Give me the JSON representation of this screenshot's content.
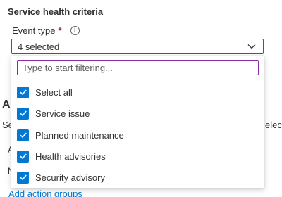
{
  "section": {
    "title": "Service health criteria"
  },
  "event_type": {
    "label": "Event type",
    "required_mark": "*",
    "info_icon": "info-icon",
    "selected_text": "4 selected"
  },
  "filter": {
    "placeholder": "Type to start filtering..."
  },
  "options": [
    {
      "label": "Select all",
      "checked": true
    },
    {
      "label": "Service issue",
      "checked": true
    },
    {
      "label": "Planned maintenance",
      "checked": true
    },
    {
      "label": "Health advisories",
      "checked": true
    },
    {
      "label": "Security advisory",
      "checked": true
    }
  ],
  "background": {
    "heading_fragment": "Ac",
    "text_left_fragment": "Se",
    "text_right_fragment": "elect",
    "row1_fragment": "A",
    "row2_fragment": "N",
    "link": "Add action groups"
  },
  "colors": {
    "accent_border": "#8a2da5",
    "checkbox": "#0078d4",
    "link": "#0078d4",
    "required": "#a4262c"
  }
}
